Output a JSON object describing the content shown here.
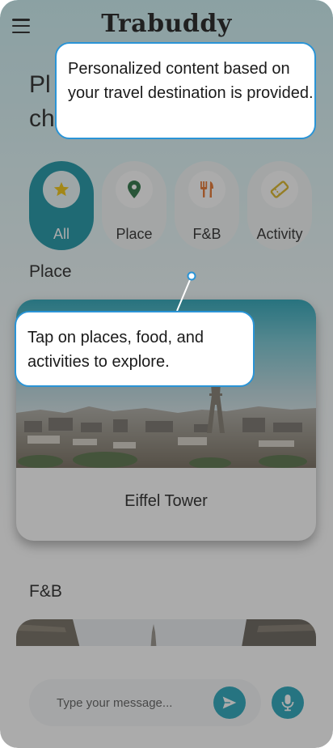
{
  "app": {
    "title": "Trabuddy"
  },
  "page": {
    "heading_line1": "Pl",
    "heading_line2": "ch"
  },
  "categories": [
    {
      "label": "All",
      "icon": "star-icon",
      "active": true
    },
    {
      "label": "Place",
      "icon": "map-pin-icon",
      "active": false
    },
    {
      "label": "F&B",
      "icon": "fork-knife-icon",
      "active": false
    },
    {
      "label": "Activity",
      "icon": "ticket-icon",
      "active": false
    }
  ],
  "sections": {
    "place": {
      "label": "Place",
      "card": {
        "name": "Eiffel Tower",
        "image": "eiffel-tower-paris-photo"
      }
    },
    "fnb": {
      "label": "F&B",
      "image": "paris-street-photo"
    }
  },
  "composer": {
    "placeholder": "Type your message...",
    "send_icon": "send-icon",
    "mic_icon": "microphone-icon"
  },
  "tutorial": {
    "tip1": "Personalized content based on your travel destination is provided.",
    "tip2": "Tap on places, food, and activities to explore."
  },
  "colors": {
    "accent": "#1aa1b7",
    "active_category": "#0f8fa0",
    "tooltip_border": "#2a94d6",
    "pin_green": "#1e6b3a",
    "food_orange": "#e56b1f",
    "ticket_yellow": "#d9b21a"
  }
}
